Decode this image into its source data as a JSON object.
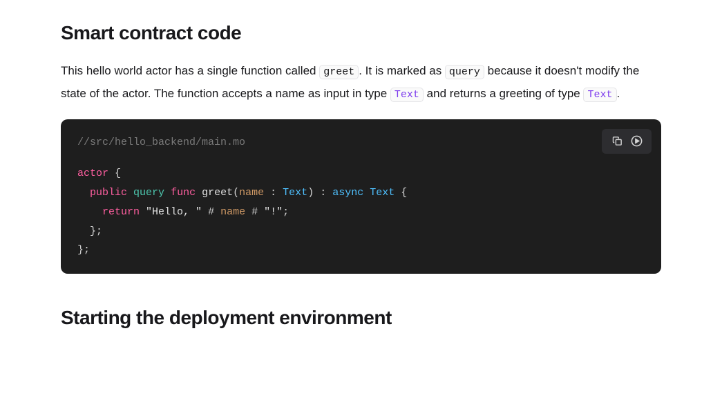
{
  "heading1": "Smart contract code",
  "paragraph": {
    "part1": "This hello world actor has a single function called ",
    "code1": "greet",
    "part2": ". It is marked as ",
    "code2": "query",
    "part3": " because it doesn't modify the state of the actor. The function accepts a name as input in type ",
    "code3": "Text",
    "part4": " and returns a greeting of type ",
    "code4": "Text",
    "part5": "."
  },
  "code": {
    "comment": "//src/hello_backend/main.mo",
    "tokens": {
      "actor": "actor",
      "brace_open": " {",
      "indent1": "  ",
      "public": "public",
      "sp": " ",
      "query": "query",
      "func": "func",
      "greet": "greet",
      "paren_open": "(",
      "name_word": "name",
      "colon_sp": " : ",
      "Text": "Text",
      "paren_close": ")",
      "async": "async",
      "brace_open2": " {",
      "indent2": "    ",
      "return": "return",
      "str1": "\"Hello, \"",
      "hash": " # ",
      "str2": "\"!\"",
      "semi": ";",
      "brace_close_semi": "};",
      "close_indent1": "  };"
    }
  },
  "heading2": "Starting the deployment environment"
}
